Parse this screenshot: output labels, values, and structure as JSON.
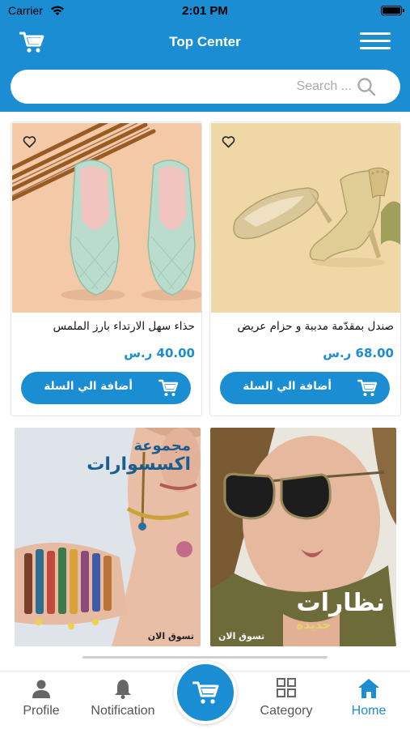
{
  "status_bar": {
    "carrier": "Carrier",
    "time": "2:01 PM"
  },
  "header": {
    "title": "Top Center"
  },
  "search": {
    "placeholder": "Search ..."
  },
  "products": [
    {
      "name": "حذاء سهل الارتداء بارز الملمس",
      "price": "40.00 ر.س",
      "add_label": "أضافة الي السلة",
      "image": "mint-green-quilted-flats"
    },
    {
      "name": "صندل بمقدّمة مدببة و حزام عريض",
      "price": "68.00 ر.س",
      "add_label": "أضافة الي السلة",
      "image": "gold-pointed-ankle-strap-heels"
    }
  ],
  "banners": [
    {
      "heading_line1": "مجموعة",
      "heading_line2": "اكسسوارات",
      "shop_now": "تسوق الان",
      "image": "accessories-bracelets-model"
    },
    {
      "heading_line1": "نظارات",
      "heading_line2": "جديدة",
      "shop_now": "تسوق الان",
      "image": "sunglasses-model"
    }
  ],
  "tabbar": {
    "profile": "Profile",
    "notification": "Notification",
    "category": "Category",
    "home": "Home",
    "active": "home"
  },
  "colors": {
    "brand": "#1b8dd2",
    "price": "#1b8dd2"
  }
}
